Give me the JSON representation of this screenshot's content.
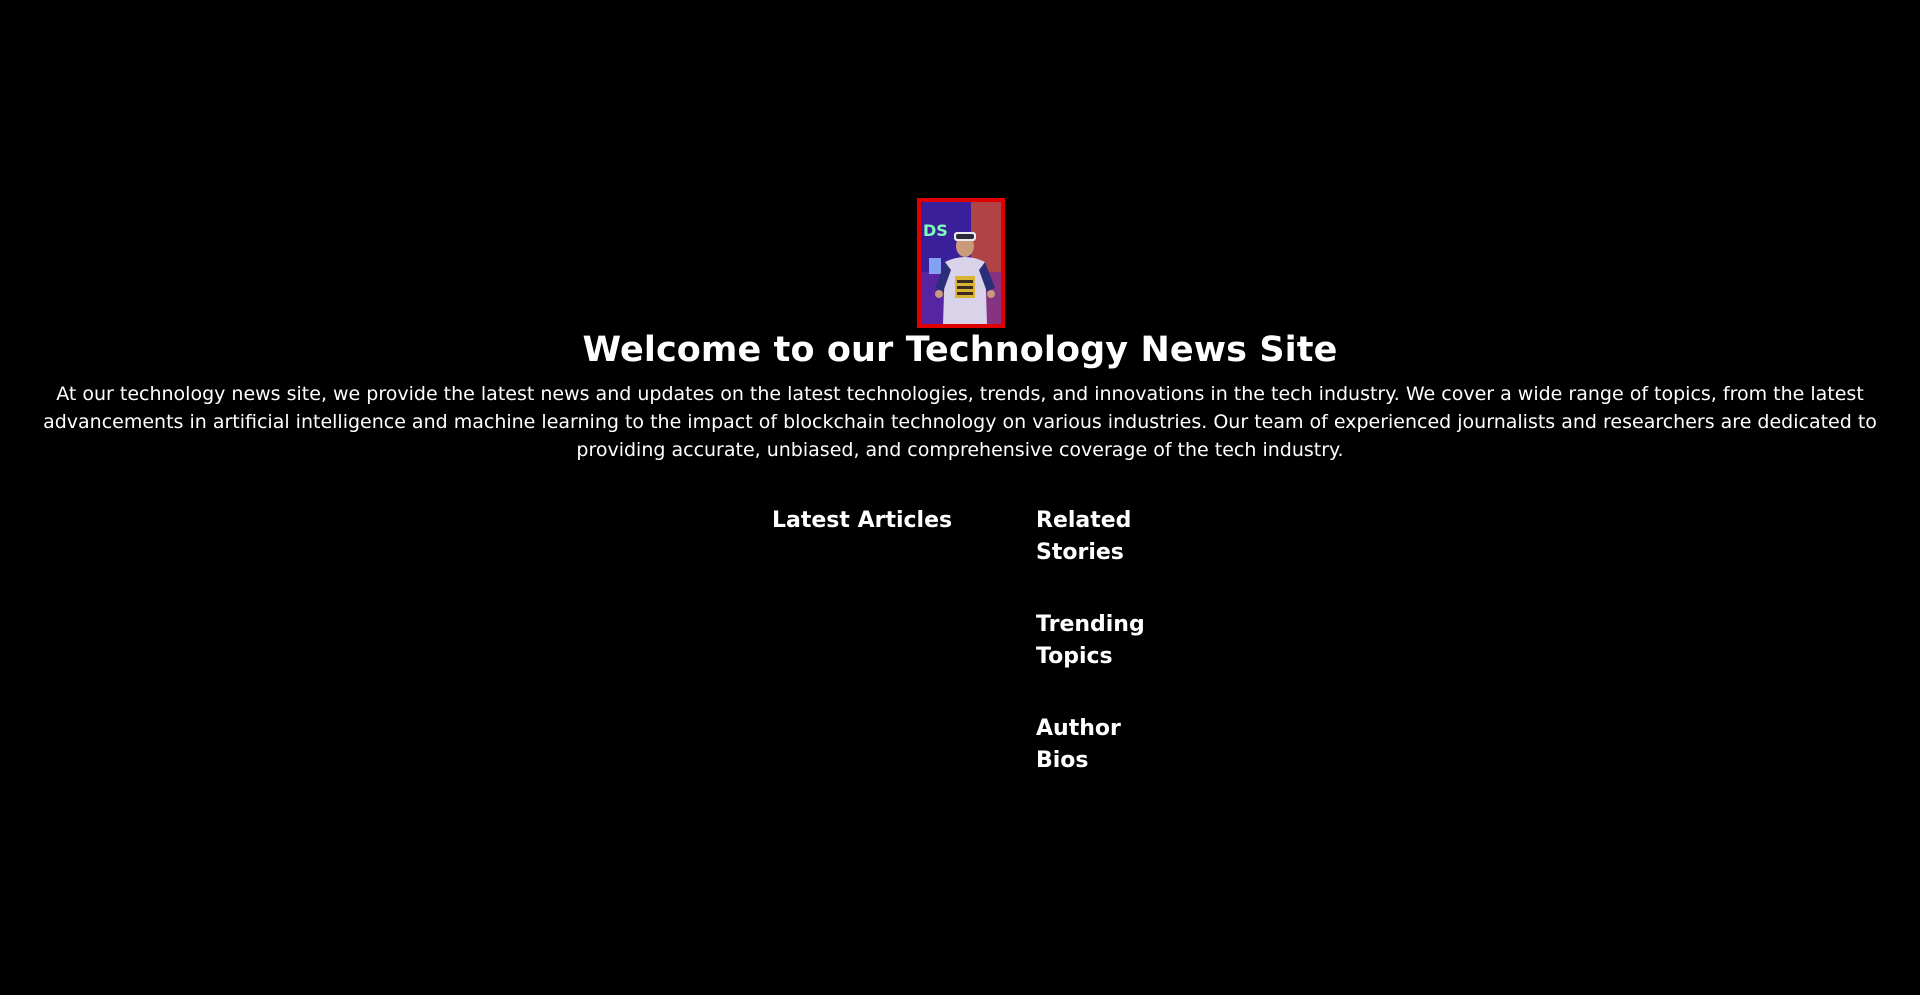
{
  "hero": {
    "image_alt": "Person wearing a VR headset in a neon-lit room"
  },
  "title": "Welcome to our Technology News Site",
  "intro": "At our technology news site, we provide the latest news and updates on the latest technologies, trends, and innovations in the tech industry. We cover a wide range of topics, from the latest advancements in artificial intelligence and machine learning to the impact of blockchain technology on various industries. Our team of experienced journalists and researchers are dedicated to providing accurate, unbiased, and comprehensive coverage of the tech industry.",
  "sections": {
    "latest_articles": "Latest Articles",
    "related_stories": "Related Stories",
    "trending_topics": "Trending Topics",
    "author_bios": "Author Bios"
  },
  "colors": {
    "background": "#000000",
    "text": "#ffffff",
    "image_border": "#e10000"
  }
}
